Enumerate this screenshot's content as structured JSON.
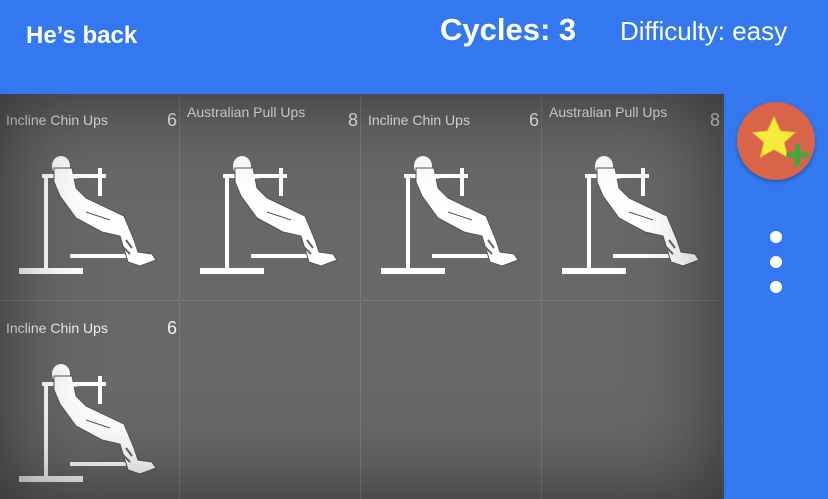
{
  "header": {
    "title": "He’s back",
    "cycles": "Cycles: 3",
    "difficulty": "Difficulty: easy"
  },
  "exercises": [
    {
      "name": "Incline Chin Ups",
      "count": "6",
      "icon": "incline-chin-up-figure-icon"
    },
    {
      "name": "Australian Pull Ups",
      "count": "8",
      "icon": "australian-pull-up-figure-icon"
    },
    {
      "name": "Incline Chin Ups",
      "count": "6",
      "icon": "incline-chin-up-figure-icon"
    },
    {
      "name": "Australian Pull Ups",
      "count": "8",
      "icon": "australian-pull-up-figure-icon"
    },
    {
      "name": "Incline Chin Ups",
      "count": "6",
      "icon": "incline-chin-up-figure-icon"
    }
  ],
  "sidebar": {
    "fab_icon": "star-plus-icon",
    "menu_icon": "more-vertical-icon"
  },
  "colors": {
    "header_bg": "#3478f0",
    "grid_bg": "#686868",
    "fab_bg": "#d9644a",
    "star": "#f6ea3a",
    "plus": "#3daa3d"
  }
}
